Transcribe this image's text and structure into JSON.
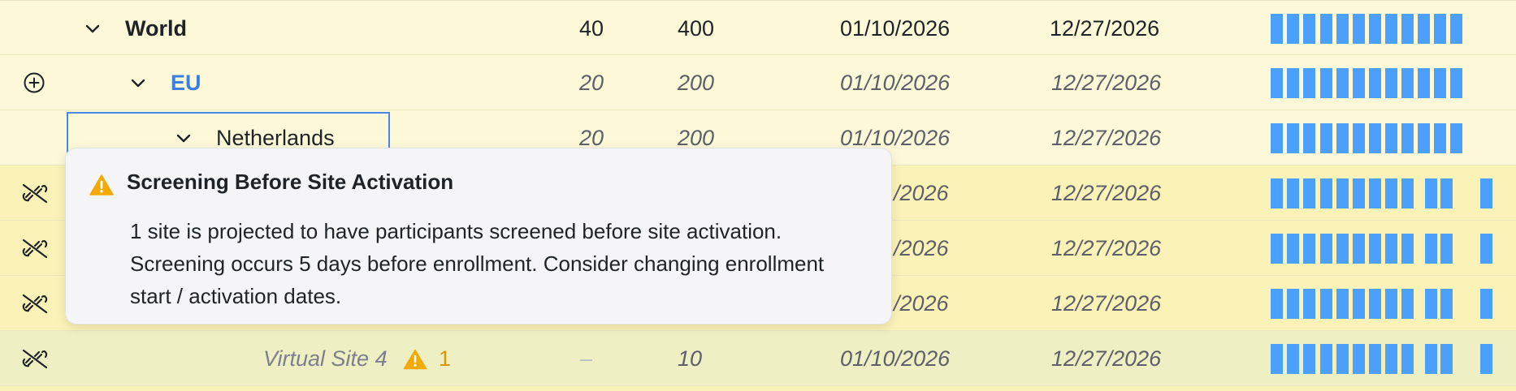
{
  "rows": [
    {
      "name": "World",
      "n1": "40",
      "n2": "400",
      "start": "01/10/2026",
      "end": "12/27/2026"
    },
    {
      "name": "EU",
      "n1": "20",
      "n2": "200",
      "start": "01/10/2026",
      "end": "12/27/2026"
    },
    {
      "name": "Netherlands",
      "n1": "20",
      "n2": "200",
      "start": "01/10/2026",
      "end": "12/27/2026"
    },
    {
      "start_partial": "/2026",
      "end": "12/27/2026"
    },
    {
      "start_partial": "/2026",
      "end": "12/27/2026"
    },
    {
      "start_partial": "/2026",
      "end": "12/27/2026"
    },
    {
      "name": "Virtual Site 4",
      "warning_count": "1",
      "n1": "–",
      "n2": "10",
      "start": "01/10/2026",
      "end": "12/27/2026"
    }
  ],
  "tooltip": {
    "title": "Screening Before Site Activation",
    "body": "1 site is projected to have participants screened before site activation. Screening occurs 5 days before enrollment. Consider changing enrollment start / activation dates."
  },
  "icons": {
    "expand": "chevron-down-icon",
    "add": "circle-plus-icon",
    "unlink": "link-broken-icon",
    "warning": "warning-triangle-icon"
  },
  "colors": {
    "bar": "#4ba0fb",
    "link": "#3b7fe0",
    "warning": "#f2a900",
    "focus": "#4a88e6"
  }
}
